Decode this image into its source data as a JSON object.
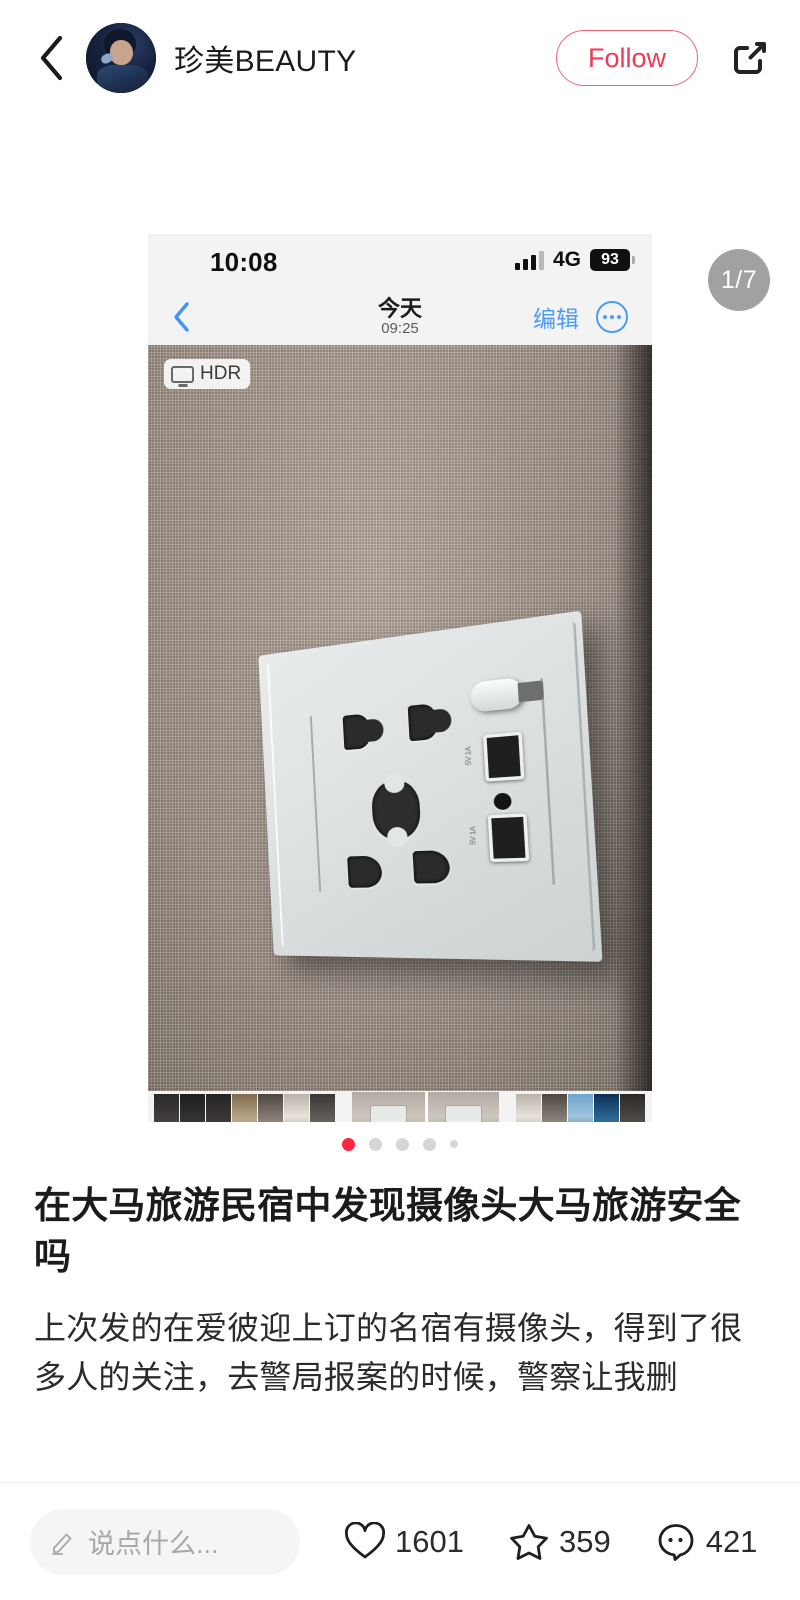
{
  "header": {
    "back_icon": "chevron-left-icon",
    "username": "珍美BEAUTY",
    "follow_label": "Follow",
    "share_icon": "share-external-icon",
    "follow_color": "#f03a55"
  },
  "carousel": {
    "page_badge": "1/7",
    "total": 7,
    "current": 1,
    "dots": [
      true,
      false,
      false,
      false,
      false
    ]
  },
  "nested_screenshot": {
    "status_bar": {
      "time": "10:08",
      "network": "4G",
      "battery": "93"
    },
    "nav": {
      "back_icon": "chevron-left-icon",
      "day": "今天",
      "time": "09:25",
      "edit_label": "编辑",
      "more_icon": "ellipsis-circle-icon"
    },
    "photo": {
      "hdr_badge": "HDR",
      "hdr_icon": "display-icon",
      "subject": "wall-power-socket"
    },
    "toolbar": [
      {
        "icon": "share-icon"
      },
      {
        "icon": "heart-icon"
      },
      {
        "icon": "pause-icon"
      },
      {
        "icon": "mute-icon"
      },
      {
        "icon": "info-icon"
      },
      {
        "icon": "trash-icon"
      }
    ],
    "accent_color": "#1a8cff"
  },
  "post": {
    "title": "在大马旅游民宿中发现摄像头大马旅游安全吗",
    "body": "上次发的在爱彼迎上订的名宿有摄像头，得到了很多人的关注，去警局报案的时候，警察让我删"
  },
  "bottom_bar": {
    "comment_placeholder": "说点什么...",
    "edit_icon": "pencil-icon",
    "like_icon": "heart-icon",
    "like_count": "1601",
    "collect_icon": "star-icon",
    "collect_count": "359",
    "comment_icon": "comment-bubble-icon",
    "comment_count": "421"
  }
}
